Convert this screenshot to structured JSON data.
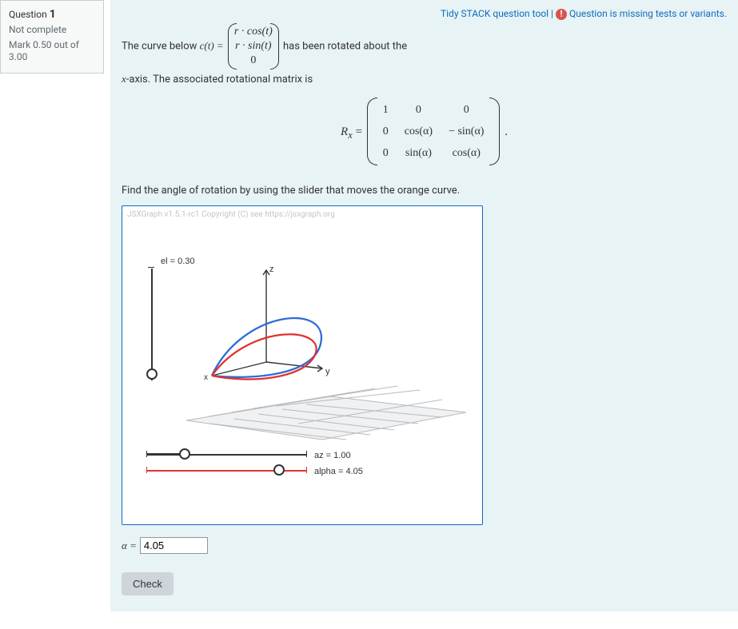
{
  "meta": {
    "question_label": "Question",
    "question_number": "1",
    "status": "Not complete",
    "mark_line": "Mark 0.50 out of 3.00"
  },
  "toplinks": {
    "tidy": "Tidy STACK question tool",
    "sep": " | ",
    "warn": "Question is missing tests or variants."
  },
  "stem": {
    "p1a": "The curve below ",
    "ct_eq": "c(t) =",
    "vec_r1": "r · cos(t)",
    "vec_r2": "r · sin(t)",
    "vec_r3": "0",
    "p1b": " has been rotated about the",
    "p2": "x-axis. The associated rotational matrix is",
    "mat_prefix_R": "R",
    "mat_prefix_sub": "x",
    "mat_eq": " = ",
    "m11": "1",
    "m12": "0",
    "m13": "0",
    "m21": "0",
    "m22": "cos(α)",
    "m23": "− sin(α)",
    "m31": "0",
    "m32": "sin(α)",
    "m33": "cos(α)",
    "mat_dot": " .",
    "instr": "Find the angle of rotation by using the slider that moves the orange curve."
  },
  "graph": {
    "copyright": "JSXGraph v1.5.1-rc1 Copyright (C) see https://jsxgraph.org",
    "el_label": "el = 0.30",
    "axis_z": "z",
    "axis_y": "y",
    "axis_x": "x",
    "az_label": "az = 1.00",
    "alpha_label": "alpha = 4.05"
  },
  "answer": {
    "alpha_sym": "α =",
    "value": "4.05"
  },
  "button": {
    "check": "Check"
  },
  "chart_data": {
    "type": "3d-curve-plot",
    "description": "3D view with z-axis up, x and y in perspective, grey ground grid in xy-plane.",
    "curves": [
      {
        "name": "original",
        "color": "#2d6cd6",
        "param": "(r cos t, r sin t, 0) rotated about x-axis (fixed target)"
      },
      {
        "name": "rotated",
        "color": "#e0332e",
        "param": "orange curve controlled by alpha slider"
      }
    ],
    "sliders": [
      {
        "name": "el",
        "value": 0.3,
        "orientation": "vertical"
      },
      {
        "name": "az",
        "value": 1.0,
        "orientation": "horizontal",
        "color": "#333"
      },
      {
        "name": "alpha",
        "value": 4.05,
        "orientation": "horizontal",
        "color": "#e0332e"
      }
    ],
    "axes": {
      "z": "up",
      "y": "right-ish",
      "x": "front-left"
    }
  }
}
